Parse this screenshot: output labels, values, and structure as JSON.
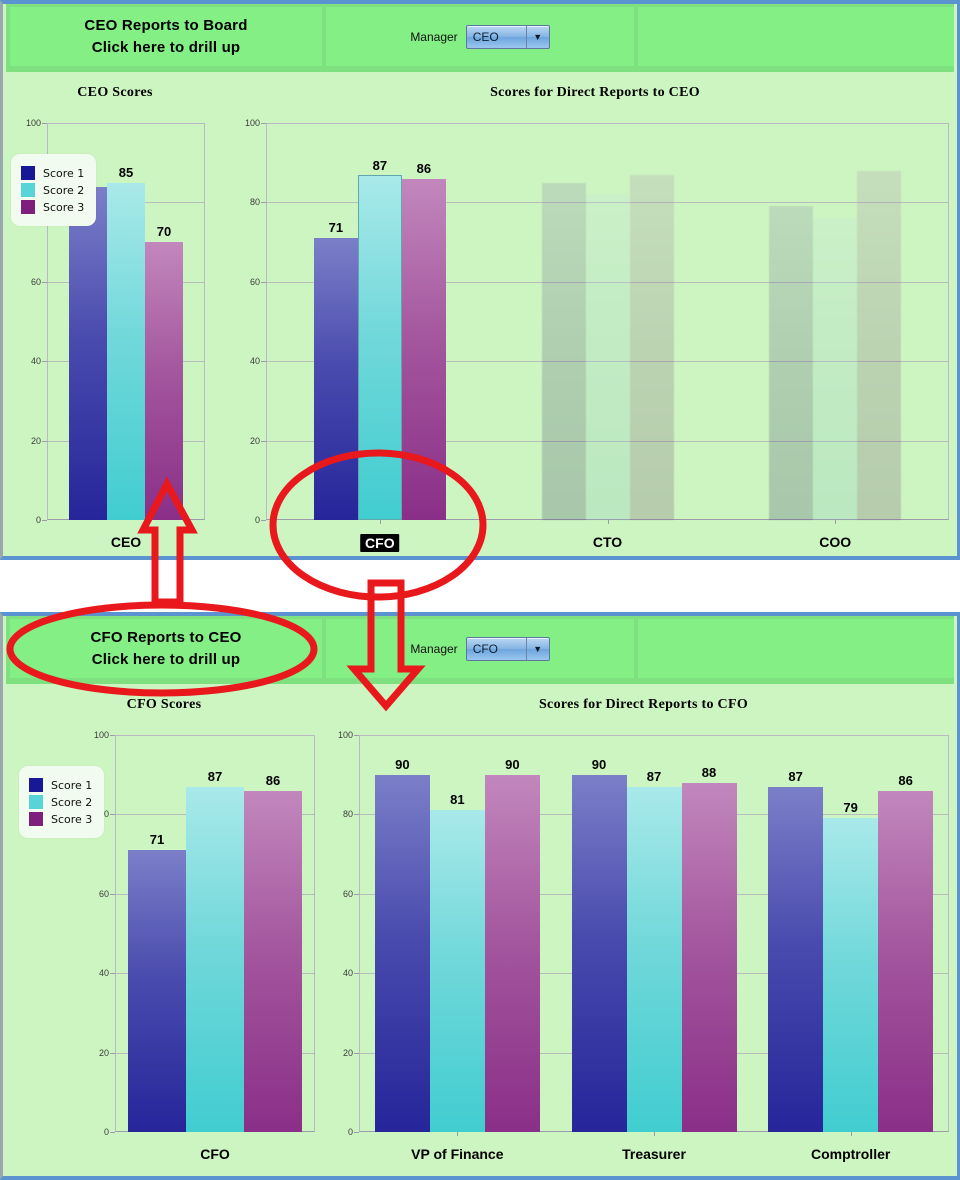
{
  "series": [
    {
      "name": "Score 1",
      "color": "#181897"
    },
    {
      "name": "Score 2",
      "color": "#58d4d8"
    },
    {
      "name": "Score 3",
      "color": "#7e1f7e"
    }
  ],
  "axis": {
    "ticks": [
      "0",
      "20",
      "40",
      "60",
      "80",
      "100"
    ],
    "min": 0,
    "max": 100
  },
  "top": {
    "drill": {
      "line1": "CEO Reports to Board",
      "line2": "Click here to drill up"
    },
    "manager": {
      "label": "Manager",
      "value": "CEO",
      "caret": "▼"
    },
    "left_chart": {
      "title": "CEO Scores",
      "category": "CEO",
      "values": [
        84,
        85,
        70
      ]
    },
    "right_chart": {
      "title": "Scores for Direct Reports to CEO",
      "groups": [
        {
          "label": "CFO",
          "selected": true,
          "faded": false,
          "values": [
            71,
            87,
            86
          ]
        },
        {
          "label": "CTO",
          "selected": false,
          "faded": true,
          "values": [
            85,
            82,
            87
          ]
        },
        {
          "label": "COO",
          "selected": false,
          "faded": true,
          "values": [
            79,
            76,
            88
          ]
        }
      ]
    }
  },
  "bottom": {
    "drill": {
      "line1": "CFO Reports to CEO",
      "line2": "Click here to drill up"
    },
    "manager": {
      "label": "Manager",
      "value": "CFO",
      "caret": "▼"
    },
    "left_chart": {
      "title": "CFO Scores",
      "category": "CFO",
      "values": [
        71,
        87,
        86
      ]
    },
    "right_chart": {
      "title": "Scores for Direct Reports to CFO",
      "groups": [
        {
          "label": "VP of Finance",
          "selected": false,
          "faded": false,
          "values": [
            90,
            81,
            90
          ]
        },
        {
          "label": "Treasurer",
          "selected": false,
          "faded": false,
          "values": [
            90,
            87,
            88
          ]
        },
        {
          "label": "Comptroller",
          "selected": false,
          "faded": false,
          "values": [
            87,
            79,
            86
          ]
        }
      ]
    }
  },
  "chart_data": [
    {
      "type": "bar",
      "title": "CEO Scores",
      "categories": [
        "CEO"
      ],
      "series": [
        {
          "name": "Score 1",
          "values": [
            84
          ]
        },
        {
          "name": "Score 2",
          "values": [
            85
          ]
        },
        {
          "name": "Score 3",
          "values": [
            70
          ]
        }
      ],
      "xlabel": "",
      "ylabel": "",
      "ylim": [
        0,
        100
      ],
      "yticks": [
        0,
        20,
        40,
        60,
        80,
        100
      ],
      "grid": true,
      "legend": "top-left"
    },
    {
      "type": "bar",
      "title": "Scores for Direct Reports to CEO",
      "categories": [
        "CFO",
        "CTO",
        "COO"
      ],
      "series": [
        {
          "name": "Score 1",
          "values": [
            71,
            85,
            79
          ]
        },
        {
          "name": "Score 2",
          "values": [
            87,
            82,
            76
          ]
        },
        {
          "name": "Score 3",
          "values": [
            86,
            87,
            88
          ]
        }
      ],
      "xlabel": "",
      "ylabel": "",
      "ylim": [
        0,
        100
      ],
      "yticks": [
        0,
        20,
        40,
        60,
        80,
        100
      ],
      "grid": true,
      "legend": "none",
      "highlighted_category": "CFO",
      "faded_categories": [
        "CTO",
        "COO"
      ]
    },
    {
      "type": "bar",
      "title": "CFO Scores",
      "categories": [
        "CFO"
      ],
      "series": [
        {
          "name": "Score 1",
          "values": [
            71
          ]
        },
        {
          "name": "Score 2",
          "values": [
            87
          ]
        },
        {
          "name": "Score 3",
          "values": [
            86
          ]
        }
      ],
      "xlabel": "",
      "ylabel": "",
      "ylim": [
        0,
        100
      ],
      "yticks": [
        0,
        20,
        40,
        60,
        80,
        100
      ],
      "grid": true,
      "legend": "top-left"
    },
    {
      "type": "bar",
      "title": "Scores for Direct Reports to CFO",
      "categories": [
        "VP of Finance",
        "Treasurer",
        "Comptroller"
      ],
      "series": [
        {
          "name": "Score 1",
          "values": [
            90,
            90,
            87
          ]
        },
        {
          "name": "Score 2",
          "values": [
            81,
            87,
            79
          ]
        },
        {
          "name": "Score 3",
          "values": [
            90,
            88,
            86
          ]
        }
      ],
      "xlabel": "",
      "ylabel": "",
      "ylim": [
        0,
        100
      ],
      "yticks": [
        0,
        20,
        40,
        60,
        80,
        100
      ],
      "grid": true,
      "legend": "none"
    }
  ],
  "annotations": {
    "color": "#e8181c",
    "items": [
      "up-arrow-ceo-to-cfo-title",
      "ellipse-around-cfo-xlabel",
      "down-arrow-to-cfo-dashboard",
      "ellipse-around-cfo-drill-title"
    ]
  }
}
